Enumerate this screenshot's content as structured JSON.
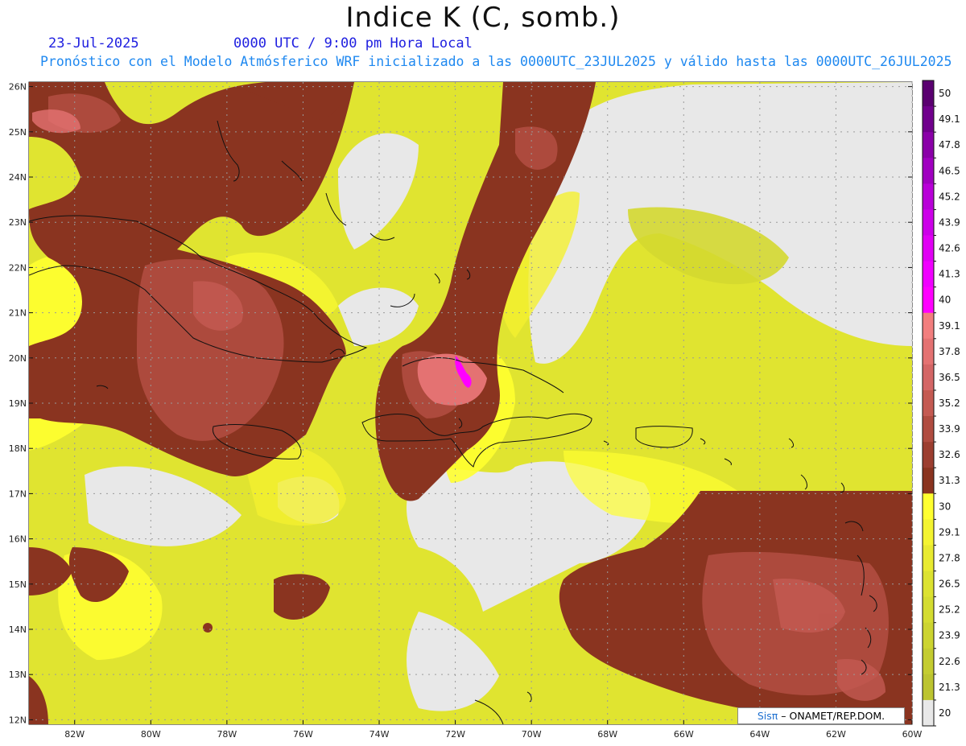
{
  "header": {
    "title": "Indice K (C, somb.)",
    "date": "23-Jul-2025",
    "time": "0000 UTC / 9:00 pm Hora Local",
    "subtitle": "Pronóstico con el Modelo Atmósferico WRF inicializado a las 0000UTC_23JUL2025 y válido hasta las  0000UTC_26JUL2025"
  },
  "map": {
    "lat_labels": [
      "26N",
      "25N",
      "24N",
      "23N",
      "22N",
      "21N",
      "20N",
      "19N",
      "18N",
      "17N",
      "16N",
      "15N",
      "14N",
      "13N",
      "12N"
    ],
    "lon_labels": [
      "82W",
      "80W",
      "78W",
      "76W",
      "74W",
      "72W",
      "70W",
      "68W",
      "66W",
      "64W",
      "62W",
      "60W"
    ],
    "colors": {
      "background": "#e8e8e8",
      "coast": "#111111",
      "grid": "#9a9a9a"
    }
  },
  "colorbar": {
    "labels": [
      "50",
      "49.1",
      "47.8",
      "46.5",
      "45.2",
      "43.9",
      "42.6",
      "41.3",
      "40",
      "39.1",
      "37.8",
      "36.5",
      "35.2",
      "33.9",
      "32.6",
      "31.3",
      "30",
      "29.1",
      "27.8",
      "26.5",
      "25.2",
      "23.9",
      "22.6",
      "21.3",
      "20"
    ],
    "colors": [
      "#5a0070",
      "#70008c",
      "#8a00a8",
      "#a000c0",
      "#b800d8",
      "#cc00e8",
      "#e000f4",
      "#f000ff",
      "#ff00ff",
      "#f27e7e",
      "#e47272",
      "#d46666",
      "#c45a52",
      "#b04c40",
      "#9c3e30",
      "#8a3420",
      "#ffff30",
      "#f4f430",
      "#e8ea30",
      "#dce230",
      "#d4dc30",
      "#ccd430",
      "#c4cc30",
      "#bcc430",
      "#e8e8e8"
    ]
  },
  "credit": {
    "logo": "Sisπ",
    "text": "– ONAMET/REP.DOM."
  }
}
